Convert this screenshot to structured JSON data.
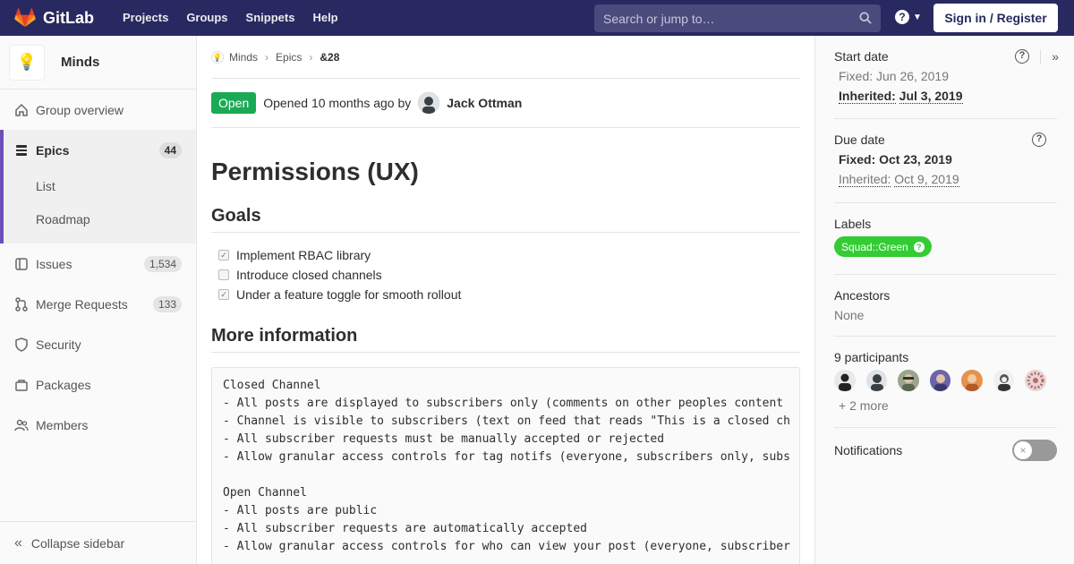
{
  "nav": {
    "brand": "GitLab",
    "links": [
      "Projects",
      "Groups",
      "Snippets",
      "Help"
    ],
    "search_placeholder": "Search or jump to…",
    "signin": "Sign in / Register"
  },
  "sidebar": {
    "group_name": "Minds",
    "items": {
      "overview": "Group overview",
      "epics": "Epics",
      "epics_count": "44",
      "list": "List",
      "roadmap": "Roadmap",
      "issues": "Issues",
      "issues_count": "1,534",
      "merge_requests": "Merge Requests",
      "mr_count": "133",
      "security": "Security",
      "packages": "Packages",
      "members": "Members"
    },
    "collapse": "Collapse sidebar"
  },
  "breadcrumbs": {
    "group": "Minds",
    "section": "Epics",
    "current": "&28"
  },
  "epic": {
    "status": "Open",
    "opened": "Opened 10 months ago by",
    "author": "Jack Ottman",
    "title": "Permissions (UX)",
    "goals_heading": "Goals",
    "tasks": [
      {
        "text": "Implement RBAC library",
        "checked": true
      },
      {
        "text": "Introduce closed channels",
        "checked": false
      },
      {
        "text": "Under a feature toggle for smooth rollout",
        "checked": true
      }
    ],
    "more_heading": "More information",
    "code": "Closed Channel\n- All posts are displayed to subscribers only (comments on other peoples content \n- Channel is visible to subscribers (text on feed that reads \"This is a closed ch\n- All subscriber requests must be manually accepted or rejected\n- Allow granular access controls for tag notifs (everyone, subscribers only, subs\n\nOpen Channel\n- All posts are public\n- All subscriber requests are automatically accepted\n- Allow granular access controls for who can view your post (everyone, subscriber"
  },
  "right": {
    "start_date_title": "Start date",
    "start_fixed_label": "Fixed:",
    "start_fixed_value": "Jun 26, 2019",
    "start_inherited_label": "Inherited:",
    "start_inherited_value": "Jul 3, 2019",
    "due_date_title": "Due date",
    "due_fixed_label": "Fixed:",
    "due_fixed_value": "Oct 23, 2019",
    "due_inherited_label": "Inherited:",
    "due_inherited_value": "Oct 9, 2019",
    "labels_title": "Labels",
    "label": "Squad::Green",
    "label_color": "#33cc33",
    "ancestors_title": "Ancestors",
    "ancestors_value": "None",
    "participants_title": "9 participants",
    "participants_more": "+ 2 more",
    "notifications_title": "Notifications"
  }
}
